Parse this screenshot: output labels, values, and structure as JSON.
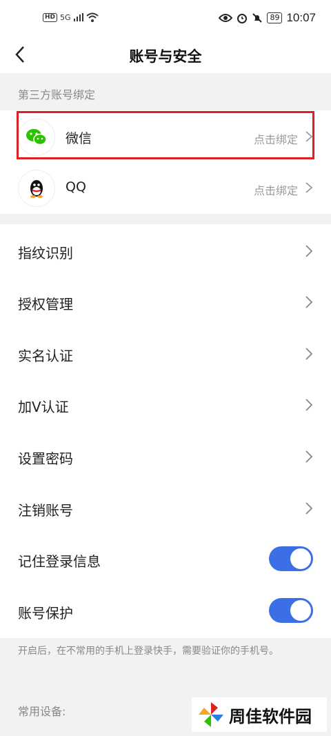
{
  "status_bar": {
    "hd": "HD",
    "network": "5G",
    "battery": "89",
    "time": "10:07"
  },
  "nav": {
    "title": "账号与安全"
  },
  "third_party": {
    "header": "第三方账号绑定",
    "items": [
      {
        "name": "微信",
        "action": "点击绑定"
      },
      {
        "name": "QQ",
        "action": "点击绑定"
      }
    ]
  },
  "settings": {
    "items": [
      {
        "label": "指纹识别"
      },
      {
        "label": "授权管理"
      },
      {
        "label": "实名认证"
      },
      {
        "label": "加V认证"
      },
      {
        "label": "设置密码"
      },
      {
        "label": "注销账号"
      }
    ],
    "toggles": [
      {
        "label": "记住登录信息",
        "on": true
      },
      {
        "label": "账号保护",
        "on": true
      }
    ]
  },
  "note": "开启后，在不常用的手机上登录快手，需要验证你的手机号。",
  "devices_header": "常用设备:",
  "watermark": "周佳软件园",
  "colors": {
    "accent": "#3c6ee6",
    "highlight": "#e02020",
    "wechat": "#2dc100"
  }
}
